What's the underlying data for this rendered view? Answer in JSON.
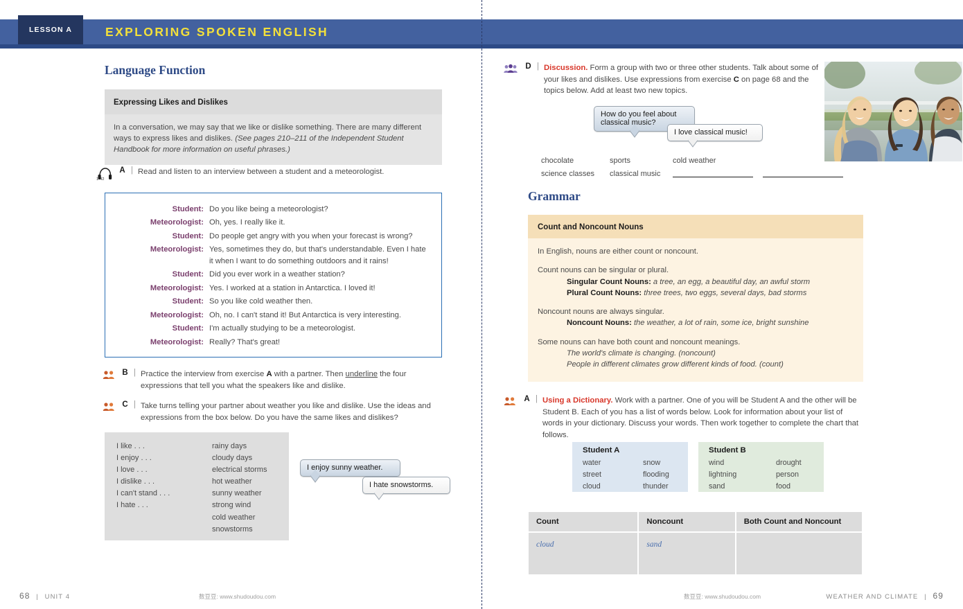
{
  "header": {
    "lesson_tab": "LESSON A",
    "title": "EXPLORING SPOKEN ENGLISH",
    "tab_color": "#24365f",
    "banner_color": "#43619f",
    "title_color": "#f3e03a"
  },
  "left_page": {
    "section_heading": "Language Function",
    "function_box": {
      "title": "Expressing Likes and Dislikes",
      "text_plain": "In a conversation, we may say that we like or dislike something. There are many different ways to express likes and dislikes. ",
      "text_italic": "(See pages 210–211 of the Independent Student Handbook for more information on useful phrases.)"
    },
    "audio_track": "1-42",
    "exercise_a": {
      "letter": "A",
      "bar": "|",
      "text": "Read and listen to an interview between a student and a meteorologist."
    },
    "dialogue": [
      {
        "speaker": "Student:",
        "line": "Do you like being a meteorologist?"
      },
      {
        "speaker": "Meteorologist:",
        "line": "Oh, yes. I really like it."
      },
      {
        "speaker": "Student:",
        "line": "Do people get angry with you when your forecast is wrong?"
      },
      {
        "speaker": "Meteorologist:",
        "line": "Yes, sometimes they do, but that's understandable. Even I hate it when I want to do something outdoors and it rains!"
      },
      {
        "speaker": "Student:",
        "line": "Did you ever work in a weather station?"
      },
      {
        "speaker": "Meteorologist:",
        "line": "Yes. I worked at a station in Antarctica. I loved it!"
      },
      {
        "speaker": "Student:",
        "line": "So you like cold weather then."
      },
      {
        "speaker": "Meteorologist:",
        "line": "Oh, no. I can't stand it! But Antarctica is very interesting."
      },
      {
        "speaker": "Student:",
        "line": "I'm actually studying to be a meteorologist."
      },
      {
        "speaker": "Meteorologist:",
        "line": "Really? That's great!"
      }
    ],
    "exercise_b": {
      "letter": "B",
      "bar": "|",
      "part1": "Practice the interview from exercise ",
      "bold1": "A",
      "part2": " with a partner. Then ",
      "underlined": "underline",
      "part3": " the four expressions that tell you what the speakers like and dislike."
    },
    "exercise_c": {
      "letter": "C",
      "bar": "|",
      "text": "Take turns telling your partner about weather you like and dislike. Use the ideas and expressions from the box below. Do you have the same likes and dislikes?"
    },
    "expressions_box": {
      "column_left": [
        "I like . . .",
        "I enjoy . . .",
        "I love . . .",
        "I dislike . . .",
        "I can't stand . . .",
        "I hate . . ."
      ],
      "column_right": [
        "rainy days",
        "cloudy days",
        "electrical storms",
        "hot weather",
        "sunny weather",
        "strong wind",
        "cold weather",
        "snowstorms"
      ]
    },
    "bubbles": [
      {
        "text": "I enjoy sunny weather."
      },
      {
        "text": "I hate snowstorms."
      }
    ],
    "footer": {
      "page": "68",
      "sep": "|",
      "unit": "UNIT 4",
      "watermark": "数豆豆: www.shudoudou.com"
    }
  },
  "right_page": {
    "exercise_d": {
      "letter": "D",
      "bar": "|",
      "label": "Discussion.",
      "text": " Form a group with two or three other students. Talk about some of your likes and dislikes. Use expressions from exercise ",
      "bold_c": "C",
      "text2": " on page 68 and the topics below. Add at least two new topics."
    },
    "bubbles": [
      {
        "text": "How do you feel about classical music?"
      },
      {
        "text": "I love classical music!"
      }
    ],
    "topics": {
      "row1": [
        "chocolate",
        "sports",
        "cold weather",
        ""
      ],
      "row2": [
        "science classes",
        "classical music",
        "",
        ""
      ]
    },
    "grammar_heading": "Grammar",
    "grammar_box": {
      "title": "Count and Noncount Nouns",
      "p1": "In English, nouns are either count or noncount.",
      "p2": "Count nouns can be singular or plural.",
      "singular_label": "Singular Count Nouns:",
      "singular_examples": "a tree, an egg, a beautiful day, an awful storm",
      "plural_label": "Plural Count Nouns:",
      "plural_examples": "three trees, two eggs, several days, bad storms",
      "p3": "Noncount nouns are always singular.",
      "noncount_label": "Noncount Nouns:",
      "noncount_examples": "the weather, a lot of rain, some ice, bright sunshine",
      "p4": "Some nouns can have both count and noncount meanings.",
      "ex1": "The world's climate is changing. (noncount)",
      "ex2": "People in different climates grow different kinds of food. (count)"
    },
    "exercise_a": {
      "letter": "A",
      "bar": "|",
      "label": "Using a Dictionary.",
      "text": " Work with a partner. One of you will be Student A and the other will be Student B. Each of you has a list of words below. Look for information about your list of words in your dictionary. Discuss your words. Then work together to complete the chart that follows."
    },
    "student_a": {
      "title": "Student A",
      "col1": [
        "water",
        "street",
        "cloud"
      ],
      "col2": [
        "snow",
        "flooding",
        "thunder"
      ],
      "bg": "#dce6f1"
    },
    "student_b": {
      "title": "Student B",
      "col1": [
        "wind",
        "lightning",
        "sand"
      ],
      "col2": [
        "drought",
        "person",
        "food"
      ],
      "bg": "#e0ebdd"
    },
    "chart": {
      "headers": [
        "Count",
        "Noncount",
        "Both Count and Noncount"
      ],
      "row": [
        "cloud",
        "sand",
        ""
      ]
    },
    "footer": {
      "unit_title": "WEATHER AND CLIMATE",
      "sep": "|",
      "page": "69",
      "watermark": "数豆豆: www.shudoudou.com"
    }
  }
}
